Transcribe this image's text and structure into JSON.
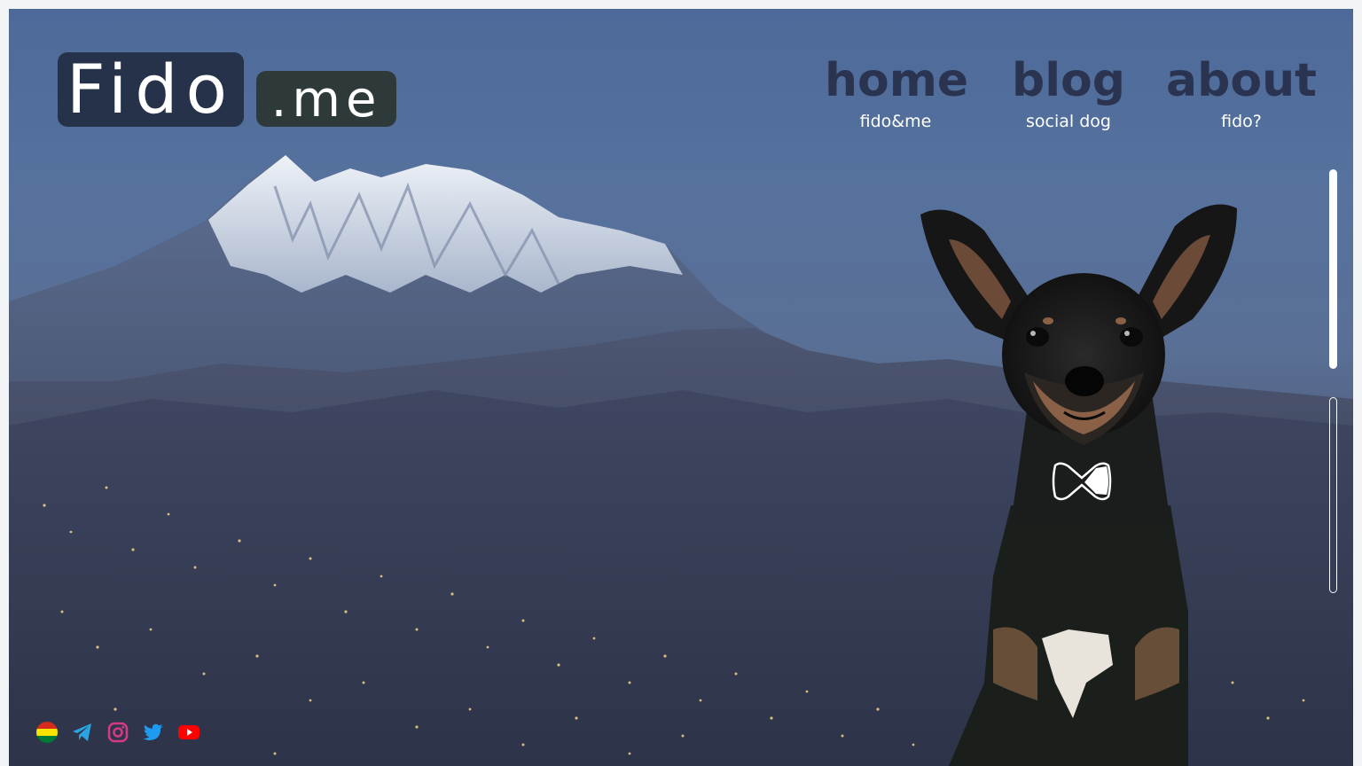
{
  "logo": {
    "main": "Fido",
    "suffix": ".me"
  },
  "nav": [
    {
      "title": "home",
      "subtitle": "fido&me"
    },
    {
      "title": "blog",
      "subtitle": "social dog"
    },
    {
      "title": "about",
      "subtitle": "fido?"
    }
  ],
  "social": [
    {
      "icon": "bolivia-flag-icon"
    },
    {
      "icon": "telegram-icon"
    },
    {
      "icon": "instagram-icon"
    },
    {
      "icon": "twitter-icon"
    },
    {
      "icon": "youtube-icon"
    }
  ],
  "colors": {
    "logo_bg": "#26324a",
    "logo_suffix_bg": "#2e3a3a",
    "nav_title": "#2a3450"
  }
}
